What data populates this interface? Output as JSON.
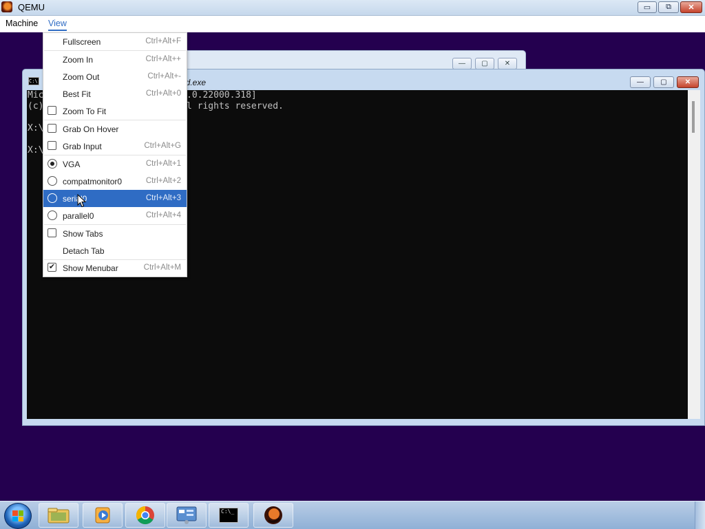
{
  "window": {
    "title": "QEMU",
    "minimize": "▭",
    "restore": "⧉",
    "close": "✕"
  },
  "menubar": {
    "items": [
      "Machine",
      "View"
    ]
  },
  "guest": {
    "cmd_title": "nd.exe",
    "console_lines": [
      "Mic",
      "(c)",
      "",
      "X:\\",
      "",
      "X:\\"
    ],
    "console_right_1": ".0.22000.318]",
    "console_right_2": "l rights reserved."
  },
  "view_menu": {
    "items": [
      {
        "label": "Fullscreen",
        "shortcut": "Ctrl+Alt+F",
        "control": "none"
      },
      {
        "label": "Zoom In",
        "shortcut": "Ctrl+Alt++",
        "control": "none"
      },
      {
        "label": "Zoom Out",
        "shortcut": "Ctrl+Alt+-",
        "control": "none"
      },
      {
        "label": "Best Fit",
        "shortcut": "Ctrl+Alt+0",
        "control": "none"
      },
      {
        "label": "Zoom To Fit",
        "shortcut": "",
        "control": "checkbox",
        "checked": false
      },
      {
        "label": "Grab On Hover",
        "shortcut": "",
        "control": "checkbox",
        "checked": false
      },
      {
        "label": "Grab Input",
        "shortcut": "Ctrl+Alt+G",
        "control": "checkbox",
        "checked": false
      },
      {
        "label": "VGA",
        "shortcut": "Ctrl+Alt+1",
        "control": "radio",
        "checked": true
      },
      {
        "label": "compatmonitor0",
        "shortcut": "Ctrl+Alt+2",
        "control": "radio",
        "checked": false
      },
      {
        "label": "serial0",
        "shortcut": "Ctrl+Alt+3",
        "control": "radio",
        "checked": false,
        "highlighted": true
      },
      {
        "label": "parallel0",
        "shortcut": "Ctrl+Alt+4",
        "control": "radio",
        "checked": false
      },
      {
        "label": "Show Tabs",
        "shortcut": "",
        "control": "checkbox",
        "checked": false
      },
      {
        "label": "Detach Tab",
        "shortcut": "",
        "control": "none"
      },
      {
        "label": "Show Menubar",
        "shortcut": "Ctrl+Alt+M",
        "control": "checkbox",
        "checked": true
      }
    ]
  },
  "taskbar": {
    "buttons": [
      "start-orb",
      "file-explorer-icon",
      "media-player-icon",
      "chrome-icon",
      "control-panel-icon",
      "command-prompt-icon",
      "qemu-icon"
    ],
    "cmd_icon_text": "C:\\_"
  },
  "colors": {
    "desktop": "#24004f",
    "menu_highlight": "#2f6cc4"
  }
}
